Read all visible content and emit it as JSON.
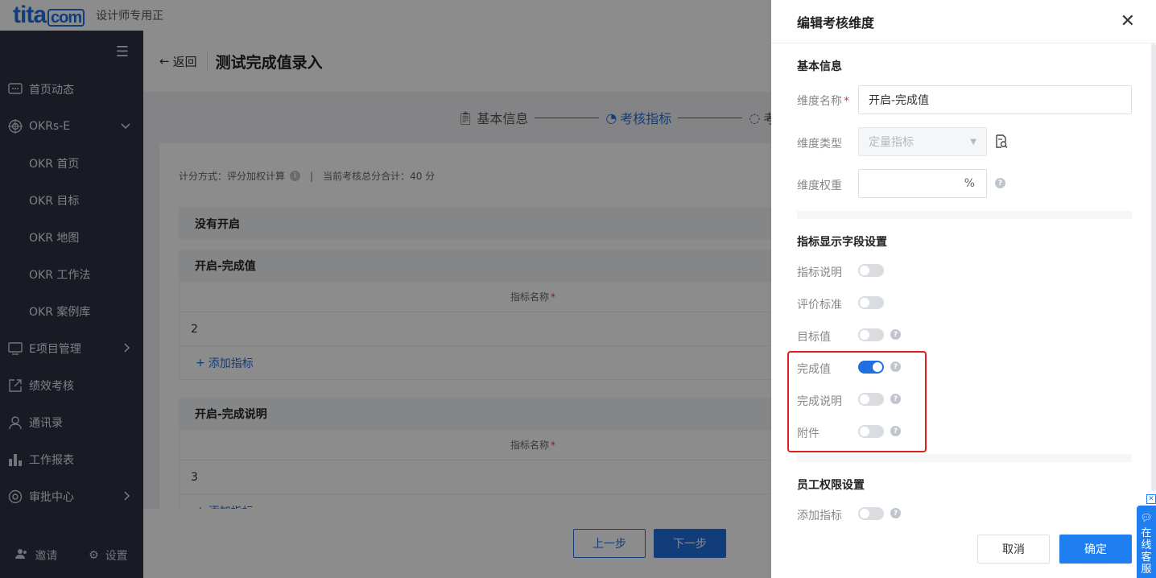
{
  "topbar": {
    "logo_main": "tita",
    "logo_com": "com",
    "subtitle": "设计师专用正"
  },
  "sidebar": {
    "items": [
      {
        "label": "首页动态",
        "icon": "chat-icon"
      },
      {
        "label": "OKRs-E",
        "icon": "target-icon",
        "arrow": "⌄"
      },
      {
        "label": "OKR 首页"
      },
      {
        "label": "OKR 目标"
      },
      {
        "label": "OKR 地图"
      },
      {
        "label": "OKR 工作法"
      },
      {
        "label": "OKR 案例库"
      },
      {
        "label": "E项目管理",
        "icon": "monitor-icon",
        "arrow": "›"
      },
      {
        "label": "绩效考核",
        "icon": "external-icon"
      },
      {
        "label": "通讯录",
        "icon": "user-icon"
      },
      {
        "label": "工作报表",
        "icon": "bar-chart-icon"
      },
      {
        "label": "审批中心",
        "icon": "approval-icon",
        "arrow": "›"
      }
    ],
    "invite": "邀请",
    "settings": "设置"
  },
  "main": {
    "back": "返回",
    "title": "测试完成值录入",
    "steps": [
      "基本信息",
      "考核指标",
      "考"
    ],
    "summary_method": "计分方式：评分加权计算",
    "summary_sep": "|",
    "summary_total": "当前考核总分合计：40 分",
    "blocks": [
      {
        "name": "没有开启"
      },
      {
        "name": "开启-完成值",
        "col": "指标名称",
        "value": "2",
        "add": "添加指标"
      },
      {
        "name": "开启-完成说明",
        "col": "指标名称",
        "value": "3",
        "add": "添加指标"
      }
    ],
    "prev": "上一步",
    "next": "下一步"
  },
  "drawer": {
    "title": "编辑考核维度",
    "basic_title": "基本信息",
    "name_label": "维度名称",
    "name_value": "开启-完成值",
    "type_label": "维度类型",
    "type_value": "定量指标",
    "weight_label": "维度权重",
    "weight_unit": "%",
    "fields_title": "指标显示字段设置",
    "toggles": [
      {
        "label": "指标说明",
        "on": false
      },
      {
        "label": "评价标准",
        "on": false
      },
      {
        "label": "目标值",
        "on": false
      },
      {
        "label": "完成值",
        "on": true
      },
      {
        "label": "完成说明",
        "on": false
      },
      {
        "label": "附件",
        "on": false
      }
    ],
    "perm_title": "员工权限设置",
    "perm_toggle": "添加指标",
    "cancel": "取消",
    "ok": "确定"
  },
  "service": {
    "label": [
      "在",
      "线",
      "客",
      "服"
    ]
  },
  "colors": {
    "primary": "#1f6fe0",
    "sidebar_bg": "#2c3142",
    "highlight": "#e02020"
  }
}
